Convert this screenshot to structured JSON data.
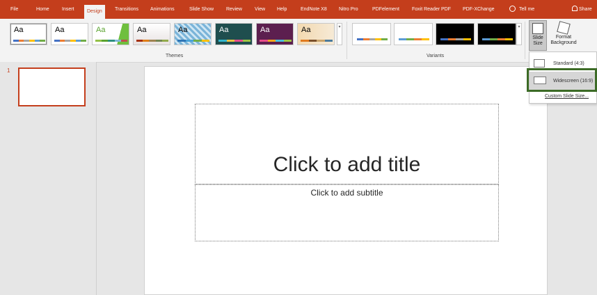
{
  "ribbon_tabs": [
    "File",
    "Home",
    "Insert",
    "Design",
    "Transitions",
    "Animations",
    "Slide Show",
    "Review",
    "View",
    "Help",
    "EndNote X8",
    "Nitro Pro",
    "PDFelement",
    "Foxit Reader PDF",
    "PDF-XChange"
  ],
  "active_tab": "Design",
  "tell_me": "Tell me",
  "share": "Share",
  "themes_label": "Themes",
  "variants_label": "Variants",
  "theme_thumb_text": "Aa",
  "slide_size_label": "Slide Size",
  "format_background_label": "Format Background",
  "slide_size_menu": {
    "standard": "Standard (4:3)",
    "widescreen": "Widescreen (16:9)",
    "custom": "Custom Slide Size..."
  },
  "slide_panel": {
    "number": "1"
  },
  "slide": {
    "title_placeholder": "Click to add title",
    "subtitle_placeholder": "Click to add subtitle"
  },
  "colors": {
    "brand": "#c43e1c",
    "highlight_border": "#3c6b26"
  }
}
